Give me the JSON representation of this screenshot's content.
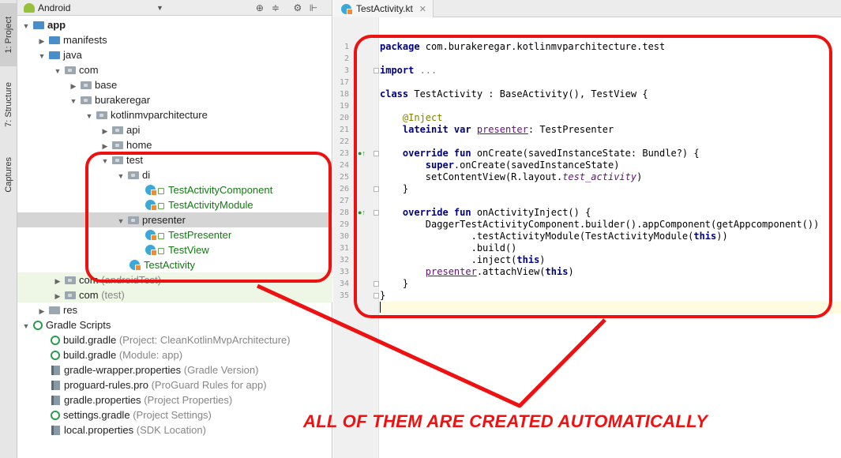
{
  "side_tabs": [
    {
      "label": "1: Project",
      "icon": "project-icon"
    },
    {
      "label": "7: Structure",
      "icon": "structure-icon"
    },
    {
      "label": "Captures",
      "icon": "captures-icon"
    }
  ],
  "project_panel": {
    "view_label": "Android",
    "toolbar_icons": [
      "target-icon",
      "collapse-icon",
      "gear-icon",
      "hide-panel-icon"
    ]
  },
  "tree": [
    {
      "label": "app",
      "extra": ""
    },
    {
      "label": "manifests",
      "extra": ""
    },
    {
      "label": "java",
      "extra": ""
    },
    {
      "label": "com",
      "extra": ""
    },
    {
      "label": "base",
      "extra": ""
    },
    {
      "label": "burakeregar",
      "extra": ""
    },
    {
      "label": "kotlinmvparchitecture",
      "extra": ""
    },
    {
      "label": "api",
      "extra": ""
    },
    {
      "label": "home",
      "extra": ""
    },
    {
      "label": "test",
      "extra": ""
    },
    {
      "label": "di",
      "extra": ""
    },
    {
      "label": "TestActivityComponent",
      "extra": ""
    },
    {
      "label": "TestActivityModule",
      "extra": ""
    },
    {
      "label": "presenter",
      "extra": ""
    },
    {
      "label": "TestPresenter",
      "extra": ""
    },
    {
      "label": "TestView",
      "extra": ""
    },
    {
      "label": "TestActivity",
      "extra": ""
    },
    {
      "label": "com",
      "extra": "(androidTest)"
    },
    {
      "label": "com",
      "extra": "(test)"
    },
    {
      "label": "res",
      "extra": ""
    },
    {
      "label": "Gradle Scripts",
      "extra": ""
    },
    {
      "label": "build.gradle",
      "extra": "(Project: CleanKotlinMvpArchitecture)"
    },
    {
      "label": "build.gradle",
      "extra": "(Module: app)"
    },
    {
      "label": "gradle-wrapper.properties",
      "extra": "(Gradle Version)"
    },
    {
      "label": "proguard-rules.pro",
      "extra": "(ProGuard Rules for app)"
    },
    {
      "label": "gradle.properties",
      "extra": "(Project Properties)"
    },
    {
      "label": "settings.gradle",
      "extra": "(Project Settings)"
    },
    {
      "label": "local.properties",
      "extra": "(SDK Location)"
    }
  ],
  "editor": {
    "tab_label": "TestActivity.kt",
    "line_numbers": [
      "1",
      "2",
      "3",
      "17",
      "18",
      "19",
      "20",
      "21",
      "22",
      "23",
      "24",
      "25",
      "26",
      "27",
      "28",
      "29",
      "30",
      "31",
      "32",
      "33",
      "34",
      "35"
    ]
  },
  "code": {
    "l1_kw": "package",
    "l1_rest": " com.burakeregar.kotlinmvparchitecture.test",
    "l3_kw": "import",
    "l3_rest": " ...",
    "l17_kw": "class",
    "l17_rest": " TestActivity : BaseActivity(), TestView {",
    "l19": "@Inject",
    "l20_kw": "lateinit var",
    "l20_prop": "presenter",
    "l20_rest": ": TestPresenter",
    "l22_kw": "override fun",
    "l22_rest": " onCreate(savedInstanceState: Bundle?) {",
    "l23_kw": "super",
    "l23_rest": ".onCreate(savedInstanceState)",
    "l24_pre": "setContentView(R.layout.",
    "l24_field": "test_activity",
    "l24_post": ")",
    "l25": "}",
    "l27_kw": "override fun",
    "l27_rest": " onActivityInject() {",
    "l28": "DaggerTestActivityComponent.builder().appComponent(getAppcomponent())",
    "l29_pre": ".testActivityModule(TestActivityModule(",
    "l29_kw": "this",
    "l29_post": "))",
    "l30": ".build()",
    "l31_pre": ".inject(",
    "l31_kw": "this",
    "l31_post": ")",
    "l32_prop": "presenter",
    "l32_pre": ".attachView(",
    "l32_kw": "this",
    "l32_post": ")",
    "l33": "}",
    "l34": "}"
  },
  "annotation": {
    "text": "ALL OF THEM ARE CREATED AUTOMATICALLY",
    "color": "#ee1111"
  },
  "colors": {
    "keyword": "#000080",
    "annotation": "#808000",
    "field": "#660e7a",
    "kotlin_file": "#127a12",
    "selection": "#d5d5d5"
  }
}
